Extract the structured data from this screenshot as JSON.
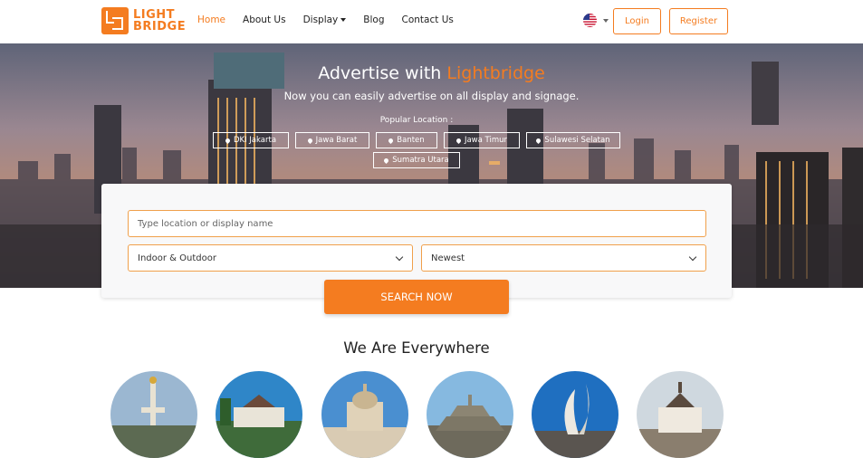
{
  "brand": {
    "line1": "LIGHT",
    "line2": "BRIDGE",
    "color": "#f47c20"
  },
  "nav": {
    "items": [
      {
        "label": "Home",
        "active": true
      },
      {
        "label": "About Us"
      },
      {
        "label": "Display",
        "dropdown": true
      },
      {
        "label": "Blog"
      },
      {
        "label": "Contact Us"
      }
    ],
    "language_flag": "us-flag-icon",
    "login_label": "Login",
    "register_label": "Register"
  },
  "hero": {
    "title_prefix": "Advertise with ",
    "title_highlight": "Lightbridge",
    "subtitle": "Now you can easily advertise on all display and signage.",
    "popular_label": "Popular Location :",
    "locations": [
      "DKI Jakarta",
      "Jawa Barat",
      "Banten",
      "Jawa Timur",
      "Sulawesi Selatan",
      "Sumatra Utara"
    ],
    "location_icon": "map-marker-icon"
  },
  "search": {
    "location_placeholder": "Type location or display name",
    "type_select_value": "Indoor & Outdoor",
    "sort_select_value": "Newest",
    "button_label": "SEARCH NOW"
  },
  "everywhere": {
    "title": "We Are Everywhere",
    "cities": [
      "jakarta-monas-image",
      "bogor-palace-image",
      "semarang-mosque-image",
      "magelang-borobudur-image",
      "surabaya-monument-image",
      "medan-building-image"
    ]
  }
}
